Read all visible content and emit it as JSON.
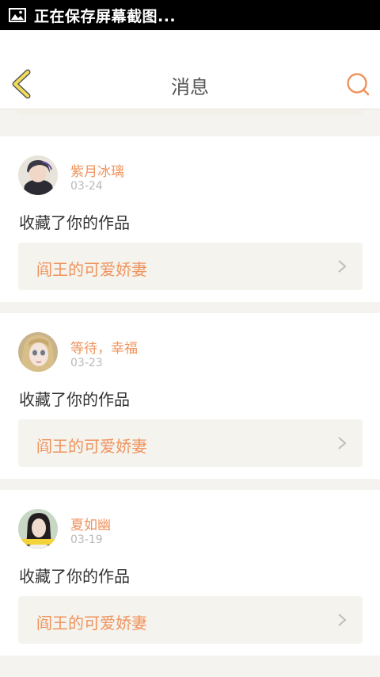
{
  "status_bar": {
    "text": "正在保存屏幕截图...",
    "icon": "image-icon"
  },
  "header": {
    "title": "消息",
    "back_icon": "back-arrow-icon",
    "search_icon": "search-icon"
  },
  "colors": {
    "accent": "#f0935c",
    "back_arrow": "#f0dc5a",
    "back_arrow_outline": "#555555",
    "background": "#f4f3ef"
  },
  "messages": [
    {
      "user": "紫月冰璃",
      "date": "03-24",
      "action": "收藏了你的作品",
      "work_title": "阎王的可爱娇妻"
    },
    {
      "user": "等待，幸福",
      "date": "03-23",
      "action": "收藏了你的作品",
      "work_title": "阎王的可爱娇妻"
    },
    {
      "user": "夏如幽",
      "date": "03-19",
      "action": "收藏了你的作品",
      "work_title": "阎王的可爱娇妻"
    }
  ]
}
